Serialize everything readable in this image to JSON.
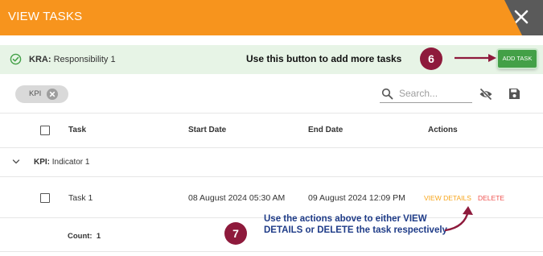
{
  "header": {
    "title": "VIEW TASKS"
  },
  "kra": {
    "prefix": "KRA:",
    "name": "Responsibility 1"
  },
  "annotations": {
    "step6": {
      "number": "6",
      "text": "Use this button to add more tasks"
    },
    "step7": {
      "number": "7",
      "text": "Use the actions above to either VIEW DETAILS or DELETE the task respectively"
    }
  },
  "toolbar": {
    "add_task_label": "ADD TASK",
    "filter_chip": "KPI",
    "search_placeholder": "Search..."
  },
  "table": {
    "columns": [
      "Task",
      "Start Date",
      "End Date",
      "Actions"
    ],
    "group": {
      "prefix": "KPI:",
      "name": "Indicator 1"
    },
    "rows": [
      {
        "task": "Task 1",
        "start": "08 August 2024 05:30 AM",
        "end": "09 August 2024 12:09 PM",
        "actions": [
          "VIEW DETAILS",
          "DELETE"
        ]
      }
    ],
    "count_label": "Count:",
    "count_value": "1"
  },
  "colors": {
    "header": "#f7941d",
    "kra_bar": "#e7f4e6",
    "add_button": "#43a047",
    "view_link": "#f7a61d",
    "delete_link": "#ef5350",
    "step_badge": "#8e1a3c",
    "hint_text": "#1f3c88"
  },
  "icons": [
    "close-icon",
    "check-circle-icon",
    "chip-remove-icon",
    "search-icon",
    "eye-off-icon",
    "save-icon",
    "chevron-down-icon"
  ]
}
